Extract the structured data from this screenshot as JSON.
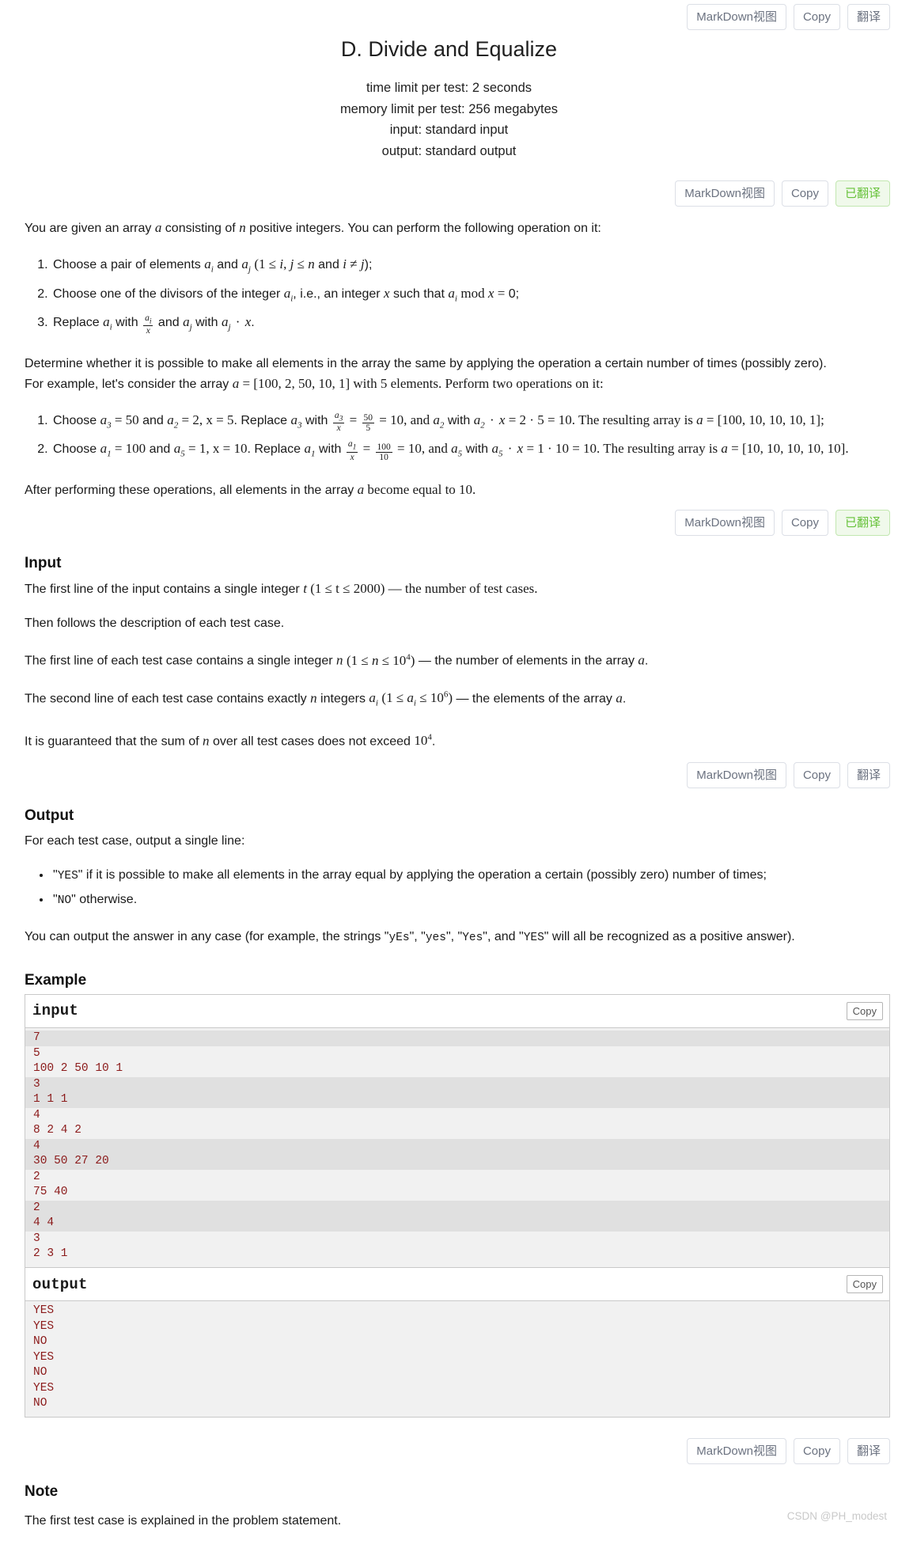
{
  "toolbars": {
    "top": {
      "markdown": "MarkDown视图",
      "copy": "Copy",
      "translate": "翻译"
    },
    "statement": {
      "markdown": "MarkDown视图",
      "copy": "Copy",
      "translate": "已翻译"
    },
    "input": {
      "markdown": "MarkDown视图",
      "copy": "Copy",
      "translate": "已翻译"
    },
    "output": {
      "markdown": "MarkDown视图",
      "copy": "Copy",
      "translate": "翻译"
    },
    "note": {
      "markdown": "MarkDown视图",
      "copy": "Copy",
      "translate": "翻译"
    }
  },
  "header": {
    "title": "D. Divide and Equalize",
    "time_limit": "time limit per test: 2 seconds",
    "memory_limit": "memory limit per test: 256 megabytes",
    "input_spec": "input: standard input",
    "output_spec": "output: standard output"
  },
  "statement": {
    "intro_1": "You are given an array ",
    "intro_2": " consisting of ",
    "intro_3": " positive integers. You can perform the following operation on it:",
    "op1_a": "Choose a pair of elements ",
    "op1_b": " and ",
    "op1_c": " and ",
    "op1_d": ");",
    "op2_a": "Choose one of the divisors of the integer ",
    "op2_b": ", i.e., an integer ",
    "op2_c": " such that ",
    "op2_d": " 0;",
    "op3_a": "Replace ",
    "op3_b": " with ",
    "op3_c": " and ",
    "op3_d": " with ",
    "op3_e": ".",
    "determine": "Determine whether it is possible to make all elements in the array the same by applying the operation a certain number of times (possibly zero).",
    "for_example_a": "For example, let's consider the array ",
    "for_example_b": " = [100, 2, 50, 10, 1] with 5 elements. Perform two operations on it:",
    "ex1_text_a": "Choose ",
    "ex1_eq1": " = 50",
    "ex1_and": " and ",
    "ex1_eq2": " = 2",
    "ex1_x": ", x = 5",
    "ex1_replace": ". Replace ",
    "ex1_with": " with ",
    "ex1_fracresult": " = 10, and ",
    "ex1_tail": " = 2 · 5 = 10. The resulting array is ",
    "ex1_array": " = [100, 10, 10, 10, 1];",
    "ex2_eq1": " = 100",
    "ex2_eq2": " = 1",
    "ex2_x": ", x = 10",
    "ex2_tail": " = 1 · 10 = 10. The resulting array is ",
    "ex2_array": " = [10, 10, 10, 10, 10].",
    "after_a": "After performing these operations, all elements in the array ",
    "after_b": " become equal to 10."
  },
  "input_section": {
    "heading": "Input",
    "p1_a": "The first line of the input contains a single integer ",
    "p1_b": " (1 ≤ t ≤ 2000) — the number of test cases.",
    "p2": "Then follows the description of each test case.",
    "p3_a": "The first line of each test case contains a single integer ",
    "p3_b": " — the number of elements in the array ",
    "p3_c": ".",
    "p4_a": "The second line of each test case contains exactly ",
    "p4_b": " integers ",
    "p4_c": " — the elements of the array ",
    "p4_d": ".",
    "p5_a": "It is guaranteed that the sum of ",
    "p5_b": " over all test cases does not exceed ",
    "p5_c": "."
  },
  "output_section": {
    "heading": "Output",
    "p1": "For each test case, output a single line:",
    "bullet1_code": "YES",
    "bullet1_text": " if it is possible to make all elements in the array equal by applying the operation a certain (possibly zero) number of times;",
    "bullet2_code": "NO",
    "bullet2_text": " otherwise.",
    "p2_a": "You can output the answer in any case (for example, the strings ",
    "p2_code1": "yEs",
    "p2_code2": "yes",
    "p2_code3": "Yes",
    "p2_code4": "YES",
    "p2_b": " will all be recognized as a positive answer)."
  },
  "example_section": {
    "heading": "Example",
    "input_label": "input",
    "output_label": "output",
    "copy_label": "Copy",
    "input_lines": [
      {
        "text": "7",
        "alt": true
      },
      {
        "text": "5",
        "alt": false
      },
      {
        "text": "100 2 50 10 1",
        "alt": false
      },
      {
        "text": "3",
        "alt": true
      },
      {
        "text": "1 1 1",
        "alt": true
      },
      {
        "text": "4",
        "alt": false
      },
      {
        "text": "8 2 4 2",
        "alt": false
      },
      {
        "text": "4",
        "alt": true
      },
      {
        "text": "30 50 27 20",
        "alt": true
      },
      {
        "text": "2",
        "alt": false
      },
      {
        "text": "75 40",
        "alt": false
      },
      {
        "text": "2",
        "alt": true
      },
      {
        "text": "4 4",
        "alt": true
      },
      {
        "text": "3",
        "alt": false
      },
      {
        "text": "2 3 1",
        "alt": false
      }
    ],
    "output_lines": [
      {
        "text": "YES",
        "alt": false
      },
      {
        "text": "YES",
        "alt": false
      },
      {
        "text": "NO",
        "alt": false
      },
      {
        "text": "YES",
        "alt": false
      },
      {
        "text": "NO",
        "alt": false
      },
      {
        "text": "YES",
        "alt": false
      },
      {
        "text": "NO",
        "alt": false
      }
    ]
  },
  "note_section": {
    "heading": "Note",
    "text": "The first test case is explained in the problem statement."
  },
  "watermark": "CSDN @PH_modest",
  "colors": {
    "accent_green": "#67c23a",
    "code_red": "#8b1a1a",
    "button_border": "#dcdfe6"
  }
}
